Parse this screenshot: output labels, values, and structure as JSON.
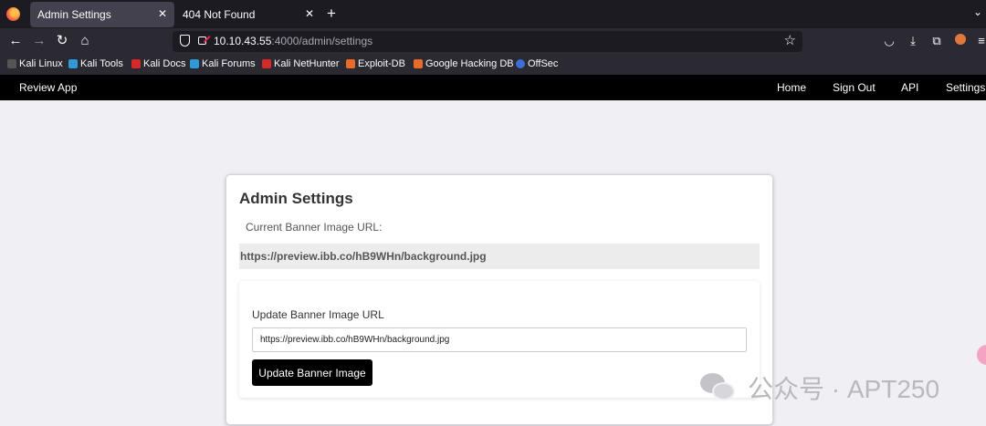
{
  "browser": {
    "tabs": [
      {
        "label": "Admin Settings",
        "active": true
      },
      {
        "label": "404 Not Found",
        "active": false
      }
    ],
    "url": {
      "host": "10.10.43.55",
      "path": ":4000/admin/settings"
    },
    "bookmarks": [
      {
        "label": "Kali Linux",
        "color": "#2e9bd6"
      },
      {
        "label": "Kali Tools",
        "color": "#2e9bd6"
      },
      {
        "label": "Kali Docs",
        "color": "#d62a2a"
      },
      {
        "label": "Kali Forums",
        "color": "#2e9bd6"
      },
      {
        "label": "Kali NetHunter",
        "color": "#d62a2a"
      },
      {
        "label": "Exploit-DB",
        "color": "#ea6a28"
      },
      {
        "label": "Google Hacking DB",
        "color": "#ea6a28"
      },
      {
        "label": "OffSec",
        "color": "#3b6fd6"
      }
    ]
  },
  "app": {
    "brand": "Review App",
    "nav": [
      "Home",
      "Sign Out",
      "API",
      "Settings"
    ]
  },
  "settings": {
    "title": "Admin Settings",
    "current_label": "Current Banner Image URL:",
    "current_value": "https://preview.ibb.co/hB9WHn/background.jpg",
    "form_label": "Update Banner Image URL",
    "input_value": "https://preview.ibb.co/hB9WHn/background.jpg",
    "button_label": "Update Banner Image"
  },
  "watermark": "公众号 · APT250"
}
